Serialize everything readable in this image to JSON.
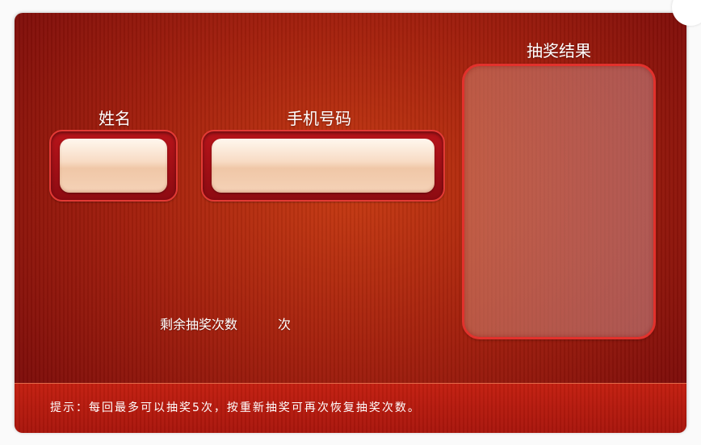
{
  "labels": {
    "name": "姓名",
    "phone": "手机号码",
    "result": "抽奖结果"
  },
  "inputs": {
    "name_value": "",
    "phone_value": ""
  },
  "remaining": {
    "prefix": "剩余抽奖次数",
    "count": "",
    "suffix": "次"
  },
  "tip": "提示：每回最多可以抽奖5次，按重新抽奖可再次恢复抽奖次数。",
  "colors": {
    "background_red": "#a11f0d",
    "border_red": "#e2312c",
    "input_peach": "#f8dcc5"
  }
}
